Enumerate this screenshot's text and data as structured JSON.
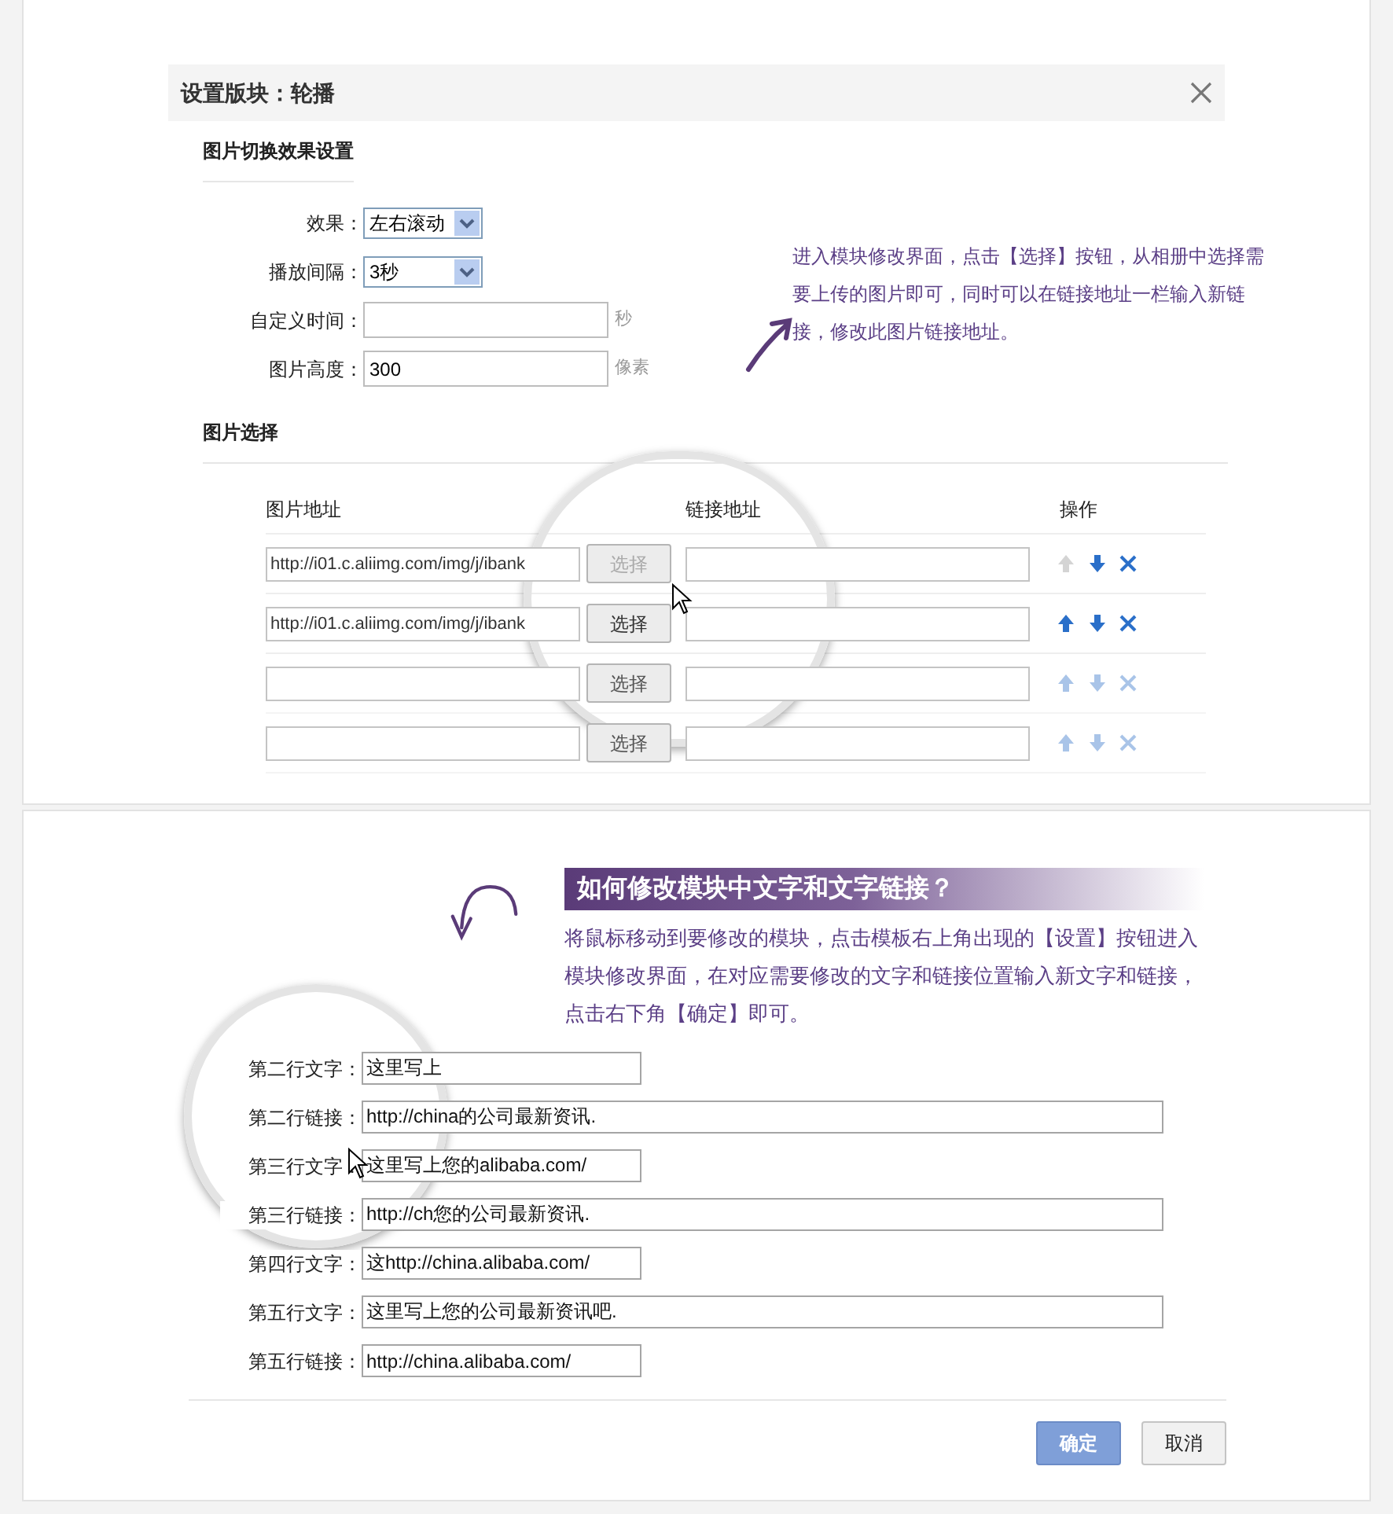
{
  "top_panel": {
    "dialog": {
      "title": "设置版块：轮播",
      "effects_section": {
        "title": "图片切换效果设置",
        "fields": [
          {
            "kind": "select",
            "label": "效果：",
            "value": "左右滚动"
          },
          {
            "kind": "select",
            "label": "播放间隔：",
            "value": "3秒"
          },
          {
            "kind": "input",
            "label": "自定义时间：",
            "unit": "秒"
          },
          {
            "kind": "input",
            "label": "图片高度：",
            "value": "300",
            "unit": "像素"
          }
        ]
      },
      "image_section": {
        "title": "图片选择",
        "columns": [
          "图片地址",
          "链接地址",
          "操作"
        ],
        "rows": [
          {
            "image_url": "http://i01.c.aliimg.com/img/j/ibank",
            "button": "选择",
            "button_disabled": true,
            "link": "",
            "up_disabled": true,
            "faded": false
          },
          {
            "image_url": "http://i01.c.aliimg.com/img/j/ibank",
            "button": "选择",
            "button_disabled": false,
            "link": "",
            "up_disabled": false,
            "faded": false
          },
          {
            "image_url": "",
            "button": "选择",
            "button_disabled": false,
            "link": "",
            "up_disabled": false,
            "faded": true
          },
          {
            "image_url": "",
            "button": "选择",
            "button_disabled": false,
            "link": "",
            "up_disabled": false,
            "faded": true
          }
        ]
      }
    },
    "hint": "进入模块修改界面，点击【选择】按钮，从相册中选择需要上传的图片即可，同时可以在链接地址一栏输入新链接，修改此图片链接地址。"
  },
  "bottom_panel": {
    "heading": "如何修改模块中文字和文字链接？",
    "hint": "将鼠标移动到要修改的模块，点击模板右上角出现的【设置】按钮进入模块修改界面，在对应需要修改的文字和链接位置输入新文字和链接，点击右下角【确定】即可。",
    "fields": [
      {
        "label": "第二行文字：",
        "value": "这里写上",
        "wide": false
      },
      {
        "label": "第二行链接：",
        "value": "http://china的公司最新资讯.",
        "wide": true
      },
      {
        "label": "第三行文字：",
        "value": "这里写上您的alibaba.com/",
        "wide": false
      },
      {
        "label": "第三行链接：",
        "value": "http://ch您的公司最新资讯.",
        "wide": true
      },
      {
        "label": "第四行文字：",
        "value": "这http://china.alibaba.com/",
        "wide": false
      },
      {
        "label": "第五行文字：",
        "value": "这里写上您的公司最新资讯吧.",
        "wide": true
      },
      {
        "label": "第五行链接：",
        "value": "http://china.alibaba.com/",
        "wide": false
      }
    ],
    "buttons": [
      {
        "label": "确定",
        "kind": "primary"
      },
      {
        "label": "取消",
        "kind": "secondary"
      }
    ]
  }
}
